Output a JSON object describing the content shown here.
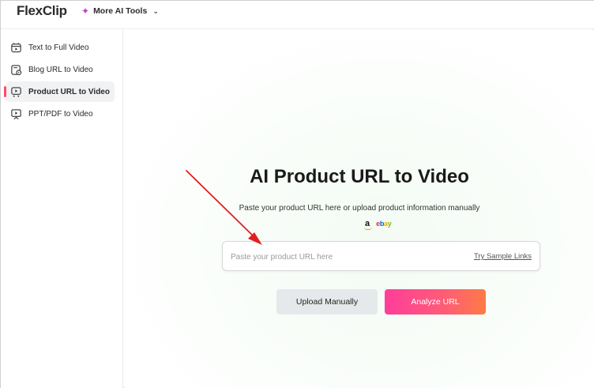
{
  "header": {
    "logo_text": "FlexClip",
    "more_tools_label": "More AI Tools"
  },
  "sidebar": {
    "items": [
      {
        "label": "Text to Full Video",
        "icon": "film-text-icon",
        "active": false
      },
      {
        "label": "Blog URL to Video",
        "icon": "blog-link-icon",
        "active": false
      },
      {
        "label": "Product URL to Video",
        "icon": "product-cart-icon",
        "active": true
      },
      {
        "label": "PPT/PDF to Video",
        "icon": "presentation-icon",
        "active": false
      }
    ]
  },
  "main": {
    "title": "AI Product URL to Video",
    "subtitle": "Paste your product URL here or upload product information manually",
    "supported_sites": [
      "amazon",
      "ebay"
    ],
    "url_input": {
      "placeholder": "Paste your product URL here",
      "value": ""
    },
    "sample_link_label": "Try Sample Links",
    "upload_button_label": "Upload Manually",
    "analyze_button_label": "Analyze URL"
  },
  "colors": {
    "accent": "#ff4d6d",
    "analyze_gradient_start": "#ff3d9a",
    "analyze_gradient_end": "#ff7a45",
    "annotation_arrow": "#e02020"
  }
}
